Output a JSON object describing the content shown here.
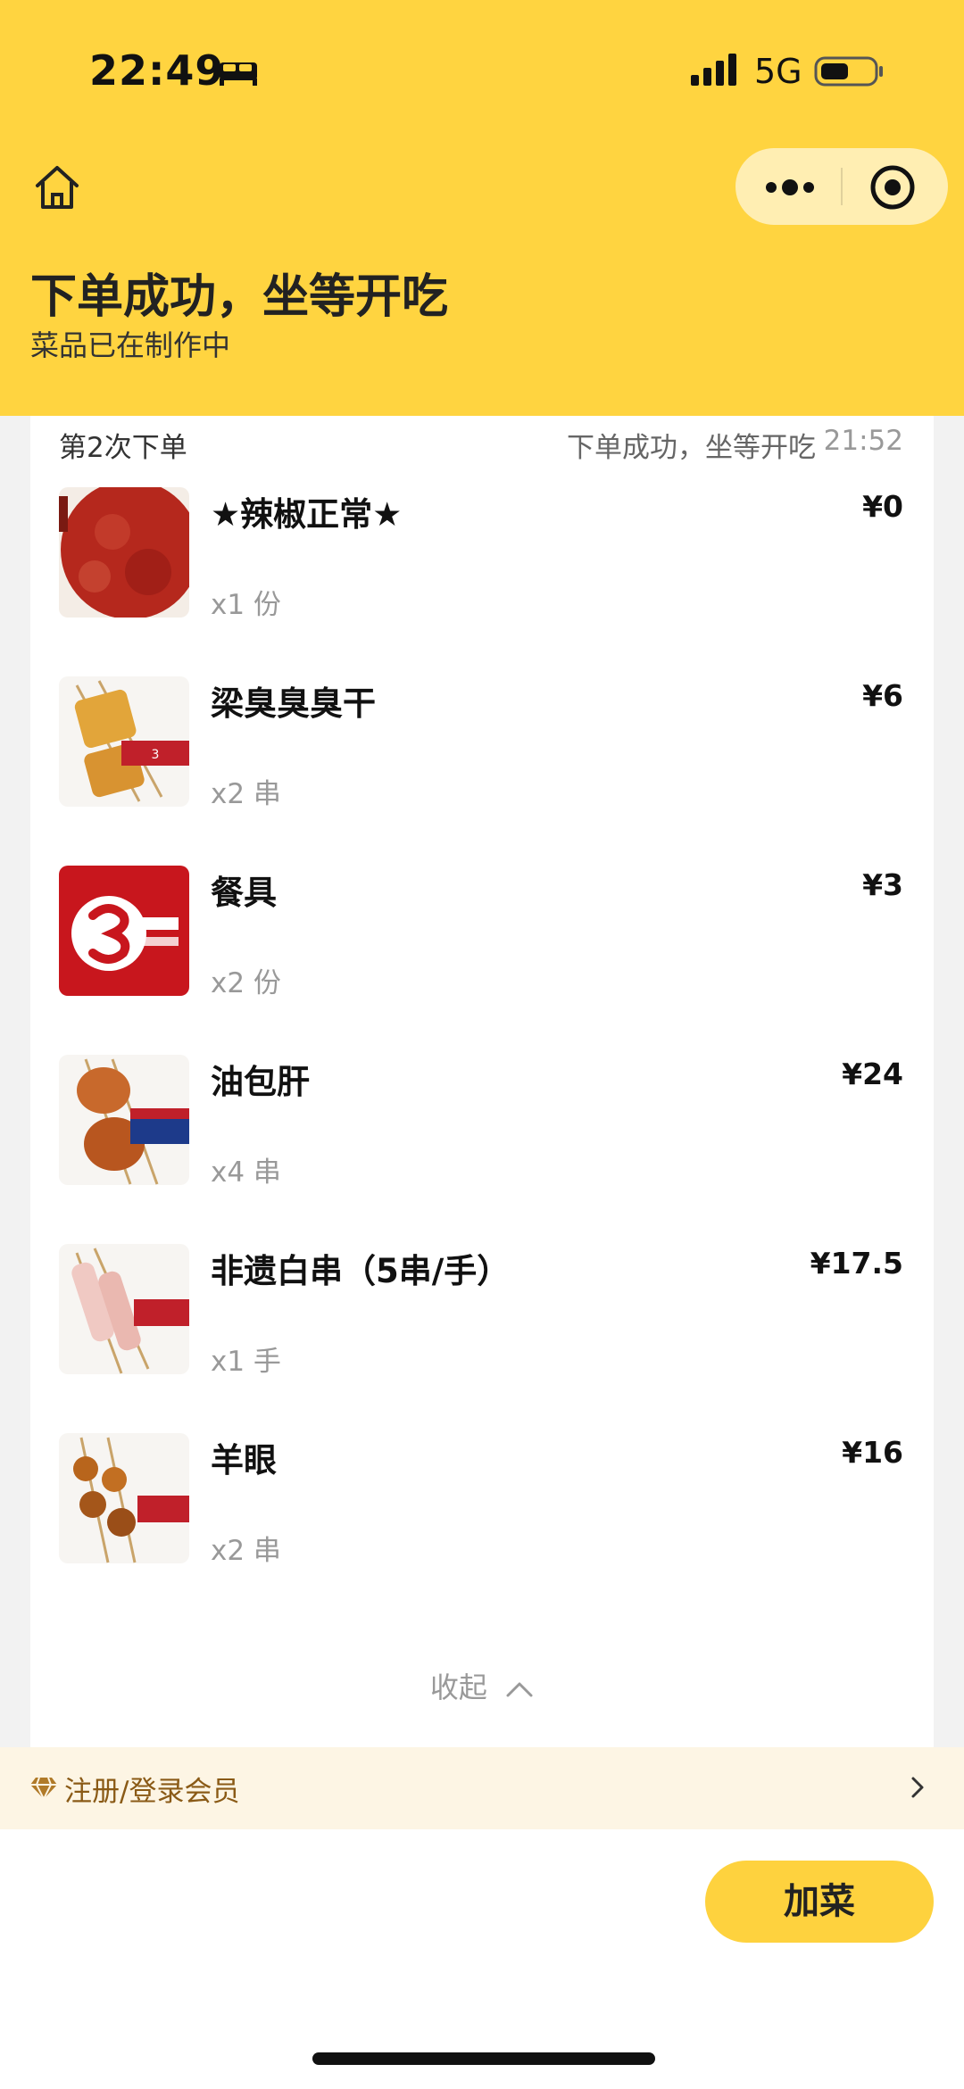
{
  "status_bar": {
    "time": "22:49",
    "network": "5G",
    "icons": [
      "bed-icon",
      "signal-icon",
      "battery-icon"
    ]
  },
  "nav": {
    "icons": [
      "home-icon",
      "more-icon",
      "target-icon"
    ]
  },
  "header": {
    "title": "下单成功，坐等开吃",
    "subtitle": "菜品已在制作中",
    "background": "#ffd440"
  },
  "order": {
    "label": "第2次下单",
    "status": "下单成功，坐等开吃",
    "time": "21:52",
    "items": [
      {
        "name": "★辣椒正常★",
        "qty": "x1 份",
        "price": "¥0",
        "icon": "chili-powder-image"
      },
      {
        "name": "梁臭臭臭干",
        "qty": "x2 串",
        "price": "¥6",
        "icon": "tofu-skewer-image"
      },
      {
        "name": "餐具",
        "qty": "x2 份",
        "price": "¥3",
        "icon": "brand-logo-image"
      },
      {
        "name": "油包肝",
        "qty": "x4 串",
        "price": "¥24",
        "icon": "liver-skewer-image"
      },
      {
        "name": "非遗白串（5串/手）",
        "qty": "x1 手",
        "price": "¥17.5",
        "icon": "white-skewer-image"
      },
      {
        "name": "羊眼",
        "qty": "x2 串",
        "price": "¥16",
        "icon": "lamb-eye-skewer-image"
      }
    ],
    "collapse_label": "收起"
  },
  "member": {
    "label": "注册/登录会员",
    "color": "#8a5a16"
  },
  "bottom": {
    "add_button": "加菜",
    "accent": "#fed23e"
  }
}
